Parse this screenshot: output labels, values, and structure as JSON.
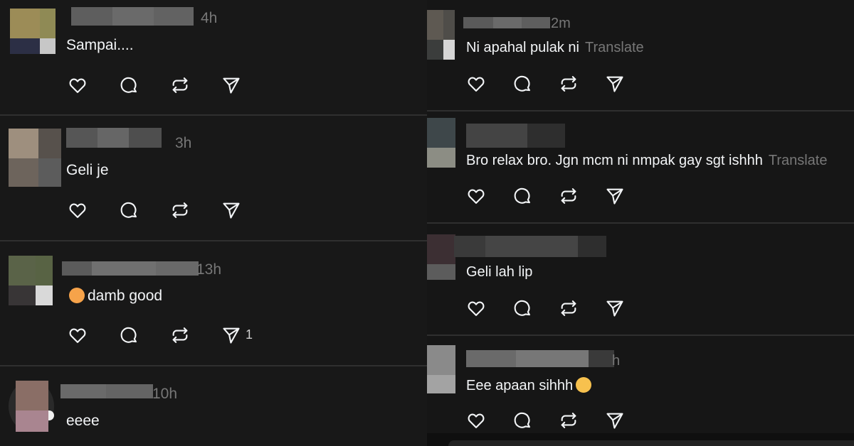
{
  "colors": {
    "background": "#181818",
    "text": "#f3f5f7",
    "muted": "#777777",
    "divider": "#2f2f2f"
  },
  "icons": [
    "heart-icon",
    "comment-icon",
    "repost-icon",
    "share-icon"
  ],
  "left_column": {
    "posts": [
      {
        "time": "4h",
        "text": "Sampai...."
      },
      {
        "time": "3h",
        "text": "Geli je"
      },
      {
        "time": "13h",
        "text": "damb good",
        "emoji": "smiling-face-emoji",
        "share_count": "1"
      },
      {
        "time": "10h",
        "text": "eeee"
      }
    ]
  },
  "right_column": {
    "posts": [
      {
        "time": "2m",
        "text": "Ni apahal pulak ni",
        "translate": "Translate"
      },
      {
        "time": "",
        "text": "Bro relax bro. Jgn mcm ni nmpak gay sgt ishhh",
        "translate": "Translate"
      },
      {
        "time": "",
        "text": "Geli lah lip"
      },
      {
        "time": "h",
        "text": "Eee apaan sihhh",
        "emoji": "rolling-eyes-emoji"
      }
    ]
  }
}
